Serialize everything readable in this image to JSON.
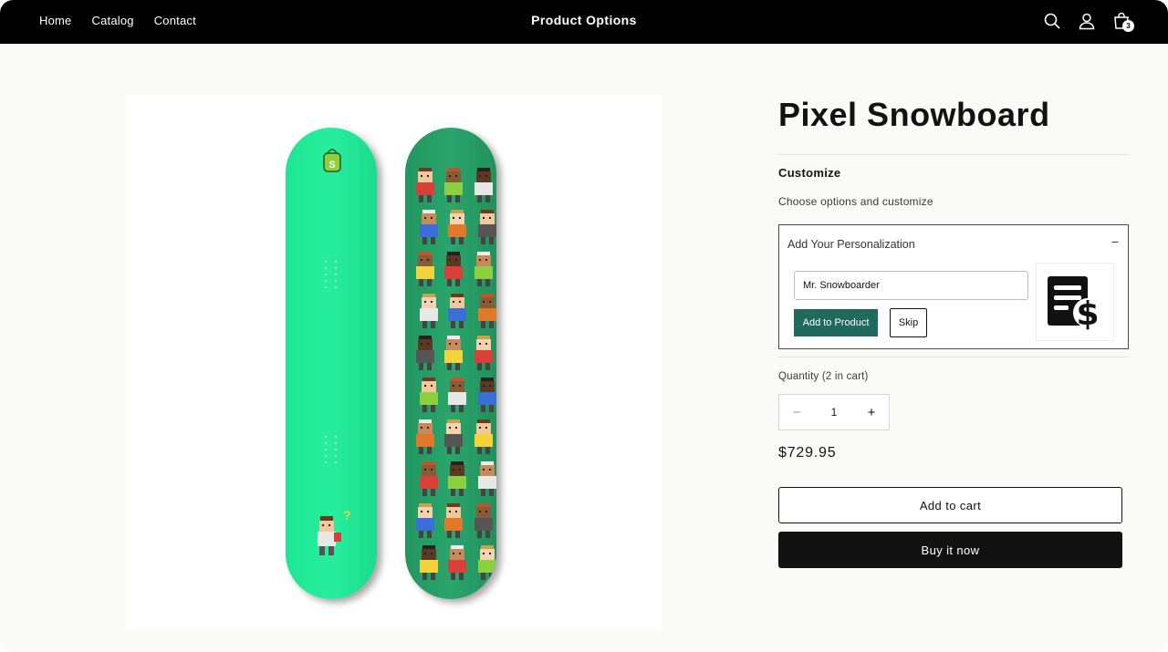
{
  "header": {
    "nav": [
      "Home",
      "Catalog",
      "Contact"
    ],
    "brand": "Product Options",
    "cart_count": "3",
    "icons": [
      "search-icon",
      "account-icon",
      "cart-icon"
    ]
  },
  "product": {
    "title": "Pixel Snowboard",
    "image_alt": "Pixel Snowboard",
    "customize": {
      "title": "Customize",
      "subtitle": "Choose options and customize"
    },
    "personalization": {
      "title": "Add Your Personalization",
      "toggle": "−",
      "input_value": "Mr. Snowboarder",
      "add_button": "Add to Product",
      "skip_button": "Skip",
      "thumb_icon": "price-document-icon"
    },
    "quantity": {
      "label": "Quantity (2 in cart)",
      "value": "1",
      "minus": "−",
      "plus": "+"
    },
    "price": "$729.95",
    "add_to_cart": "Add to cart",
    "buy_now": "Buy it now"
  },
  "colors": {
    "header_bg": "#000000",
    "accent_button": "#1f6a5c",
    "board_mint": "#22e69a",
    "board_green": "#2aa06a"
  }
}
